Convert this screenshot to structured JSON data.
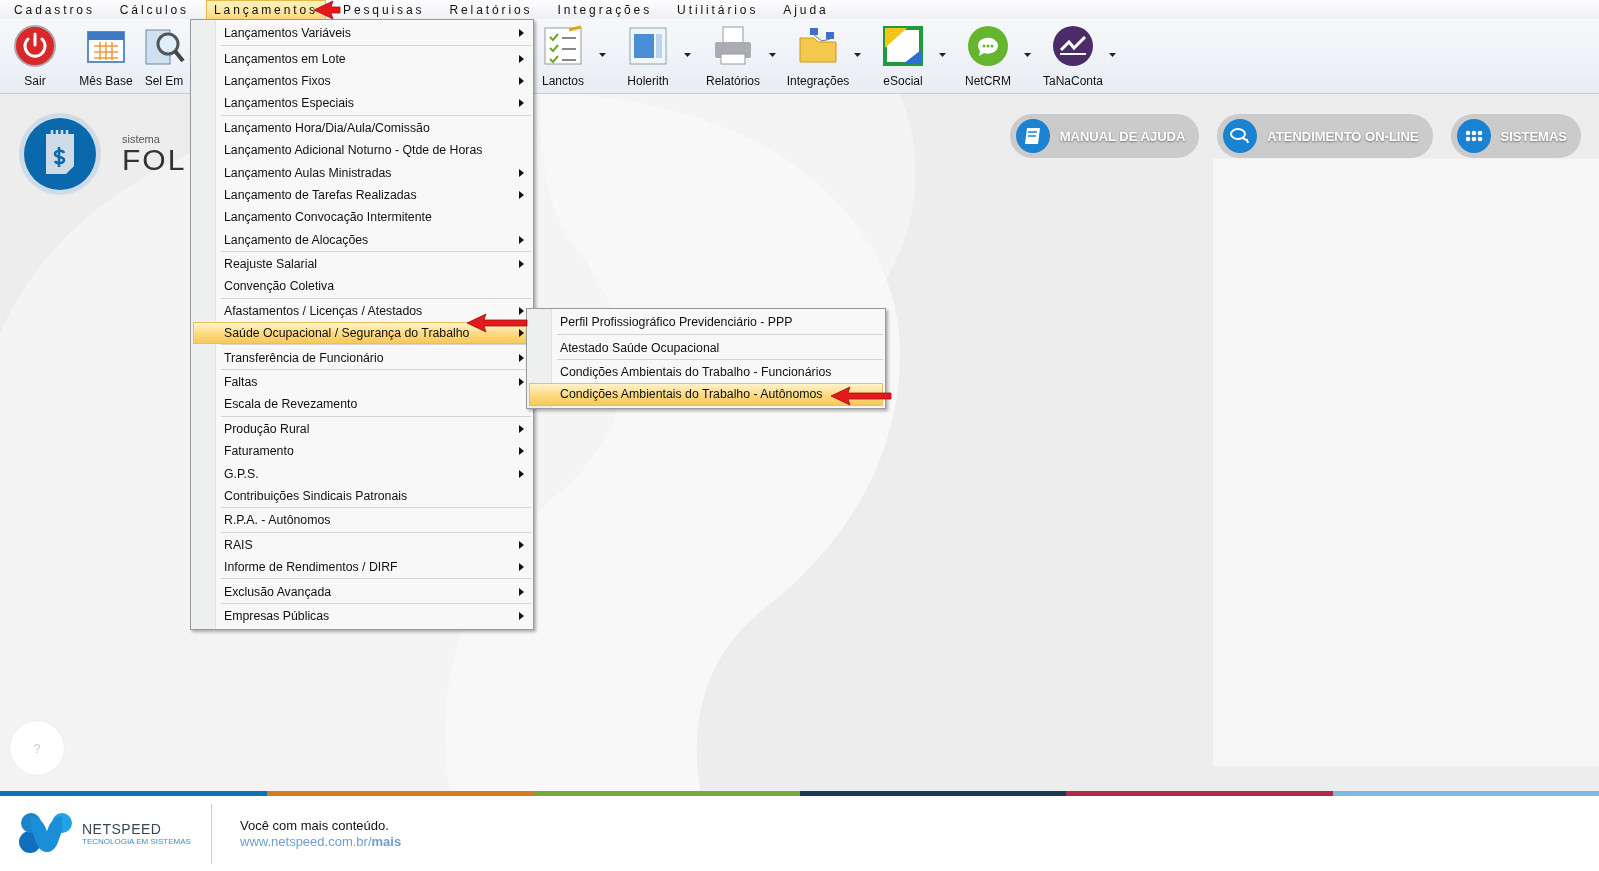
{
  "menu_bar": [
    {
      "label": "Cadastros",
      "selected": false
    },
    {
      "label": "Cálculos",
      "selected": false
    },
    {
      "label": "Lançamentos",
      "selected": true
    },
    {
      "label": "Pesquisas",
      "selected": false
    },
    {
      "label": "Relatórios",
      "selected": false
    },
    {
      "label": "Integrações",
      "selected": false
    },
    {
      "label": "Utilitários",
      "selected": false
    },
    {
      "label": "Ajuda",
      "selected": false
    }
  ],
  "toolbar": [
    {
      "label": "Sair",
      "dropdown": false
    },
    {
      "label": "Mês Base",
      "dropdown": false
    },
    {
      "label": "Sel Em",
      "dropdown": false
    },
    {
      "label": "Lanctos",
      "dropdown": true
    },
    {
      "label": "Holerith",
      "dropdown": true
    },
    {
      "label": "Relatórios",
      "dropdown": true
    },
    {
      "label": "Integrações",
      "dropdown": true
    },
    {
      "label": "eSocial",
      "dropdown": true
    },
    {
      "label": "NetCRM",
      "dropdown": true
    },
    {
      "label": "TaNaConta",
      "dropdown": true
    }
  ],
  "dropdown_menu": {
    "groups": [
      [
        {
          "label": "Lançamentos Variáveis",
          "submenu": true,
          "selected": false
        }
      ],
      [
        {
          "label": "Lançamentos em Lote",
          "submenu": true,
          "selected": false
        },
        {
          "label": "Lançamentos Fixos",
          "submenu": true,
          "selected": false
        },
        {
          "label": "Lançamentos Especiais",
          "submenu": true,
          "selected": false
        }
      ],
      [
        {
          "label": "Lançamento Hora/Dia/Aula/Comissão",
          "submenu": false,
          "selected": false
        },
        {
          "label": "Lançamento Adicional Noturno - Qtde de Horas",
          "submenu": false,
          "selected": false
        },
        {
          "label": "Lançamento Aulas Ministradas",
          "submenu": true,
          "selected": false
        },
        {
          "label": "Lançamento de Tarefas Realizadas",
          "submenu": true,
          "selected": false
        },
        {
          "label": "Lançamento Convocação Intermitente",
          "submenu": false,
          "selected": false
        },
        {
          "label": "Lançamento de Alocações",
          "submenu": true,
          "selected": false
        }
      ],
      [
        {
          "label": "Reajuste Salarial",
          "submenu": true,
          "selected": false
        },
        {
          "label": "Convenção Coletiva",
          "submenu": false,
          "selected": false
        }
      ],
      [
        {
          "label": "Afastamentos / Licenças / Atestados",
          "submenu": true,
          "selected": false
        },
        {
          "label": "Saúde Ocupacional / Segurança do Trabalho",
          "submenu": true,
          "selected": true
        }
      ],
      [
        {
          "label": "Transferência de Funcionário",
          "submenu": true,
          "selected": false
        }
      ],
      [
        {
          "label": "Faltas",
          "submenu": true,
          "selected": false
        },
        {
          "label": "Escala de Revezamento",
          "submenu": false,
          "selected": false
        }
      ],
      [
        {
          "label": "Produção Rural",
          "submenu": true,
          "selected": false
        },
        {
          "label": "Faturamento",
          "submenu": true,
          "selected": false
        },
        {
          "label": "G.P.S.",
          "submenu": true,
          "selected": false
        },
        {
          "label": "Contribuições Sindicais Patronais",
          "submenu": false,
          "selected": false
        }
      ],
      [
        {
          "label": "R.P.A. - Autônomos",
          "submenu": false,
          "selected": false
        }
      ],
      [
        {
          "label": "RAIS",
          "submenu": true,
          "selected": false
        },
        {
          "label": "Informe de Rendimentos / DIRF",
          "submenu": true,
          "selected": false
        }
      ],
      [
        {
          "label": "Exclusão Avançada",
          "submenu": true,
          "selected": false
        }
      ],
      [
        {
          "label": "Empresas Públicas",
          "submenu": true,
          "selected": false
        }
      ]
    ]
  },
  "submenu": {
    "groups": [
      [
        {
          "label": "Perfil Profissiográfico Previdenciário - PPP",
          "submenu": false,
          "selected": false
        }
      ],
      [
        {
          "label": "Atestado Saúde Ocupacional",
          "submenu": false,
          "selected": false
        }
      ],
      [
        {
          "label": "Condições Ambientais do Trabalho - Funcionários",
          "submenu": false,
          "selected": false
        },
        {
          "label": "Condições Ambientais do Trabalho - Autônomos",
          "submenu": false,
          "selected": true
        }
      ]
    ]
  },
  "logo": {
    "caption": "sistema",
    "name": "FOL"
  },
  "quick_buttons": [
    "MANUAL DE AJUDA",
    "ATENDIMENTO ON-LINE",
    "SISTEMAS"
  ],
  "help_button": "?",
  "footer": {
    "brand": "NETSPEED",
    "tagline": "TECNOLOGIA EM SISTEMAS",
    "text": "Você com mais conteúdo.",
    "link": "www.netspeed.com.br/**mais**"
  }
}
